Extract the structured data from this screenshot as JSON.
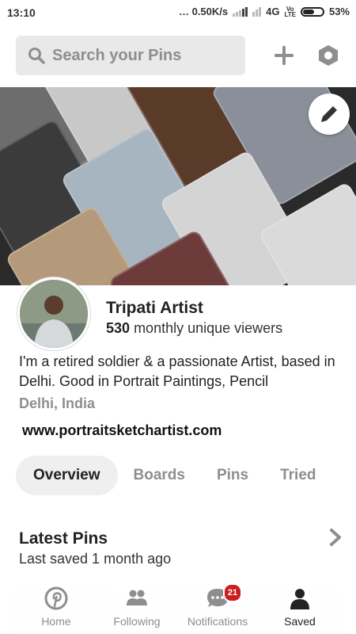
{
  "status_bar": {
    "time": "13:10",
    "network_speed": "0.50K/s",
    "network_type": "4G",
    "volte": "Vo LTE",
    "battery_percent": "53%",
    "battery_level": 0.53
  },
  "header": {
    "search_placeholder": "Search your Pins",
    "icons": {
      "search": "search-icon",
      "add": "plus-icon",
      "settings": "hexagon-settings-icon"
    }
  },
  "cover": {
    "edit_icon": "pencil-icon",
    "tile_colors": [
      "#6d6d6d",
      "#c8c8c8",
      "#5a3b2a",
      "#8a8f99",
      "#3b3b3b",
      "#a7b5c0",
      "#d4d4d4",
      "#b49a7a",
      "#dadada",
      "#6e3b3b"
    ]
  },
  "profile": {
    "name": "Tripati Artist",
    "viewers_count": "530",
    "viewers_label": "monthly unique viewers",
    "bio": "I'm a retired soldier & a passionate Artist, based in  Delhi. Good in Portrait Paintings, Pencil",
    "location": "Delhi, India",
    "website": "www.portraitsketchartist.com"
  },
  "tabs": [
    {
      "label": "Overview",
      "active": true
    },
    {
      "label": "Boards",
      "active": false
    },
    {
      "label": "Pins",
      "active": false
    },
    {
      "label": "Tried",
      "active": false
    }
  ],
  "latest_pins": {
    "title": "Latest Pins",
    "subtitle": "Last saved 1 month ago"
  },
  "bottom_nav": {
    "items": [
      {
        "label": "Home",
        "icon": "pinterest-logo-icon"
      },
      {
        "label": "Following",
        "icon": "people-icon"
      },
      {
        "label": "Notifications",
        "icon": "chat-bubble-icon",
        "badge": "21"
      },
      {
        "label": "Saved",
        "icon": "person-icon",
        "active": true
      }
    ]
  },
  "colors": {
    "brand_red": "#cc1f1f",
    "search_bg": "#e9e9e9",
    "muted_text": "#8e8e8e",
    "active_tab_bg": "#efefef"
  }
}
